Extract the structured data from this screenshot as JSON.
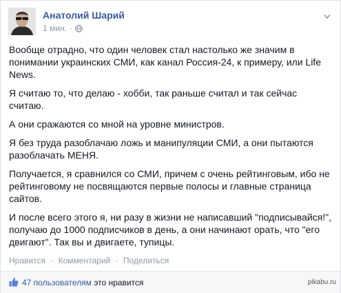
{
  "post": {
    "author": "Анатолий Шарий",
    "time": "1 мин.",
    "meta_separator": "·",
    "icons": {
      "privacy": "globe-icon",
      "options": "chevron-down-icon",
      "like": "thumbs-up-icon"
    },
    "paragraphs": [
      "Вообще отрадно, что один человек стал настолько же значим в понимании украинских СМИ, как канал Россия-24, к примеру, или Life News.",
      "Я считаю то, что делаю - хобби, так раньше считал и так сейчас считаю.",
      "А они сражаются со мной на уровне министров.",
      "Я без труда разоблачаю ложь и манипуляции СМИ, а они пытаются разоблачать МЕНЯ.",
      "Получается, я сравнился со СМИ, причем с очень рейтинговым, ибо не рейтинговому не посвящаются первые полосы и главные страница сайтов.",
      "И после всего этого я, ни разу в жизни не написавший \"подписывайся!\", получаю до 1000 подписчиков в день, а они начинают орать, что \"его двигают\". Так вы и двигаете, тупицы."
    ]
  },
  "actions": {
    "like": "Нравится",
    "comment": "Комментарий",
    "share": "Поделиться",
    "separator": "·"
  },
  "likes": {
    "count": "47 пользователям",
    "text": "это нравится"
  },
  "watermark": "pikabu.ru",
  "colors": {
    "link": "#3b5998",
    "muted": "#9197a3",
    "text": "#141823",
    "bar": "#f6f7f8"
  }
}
